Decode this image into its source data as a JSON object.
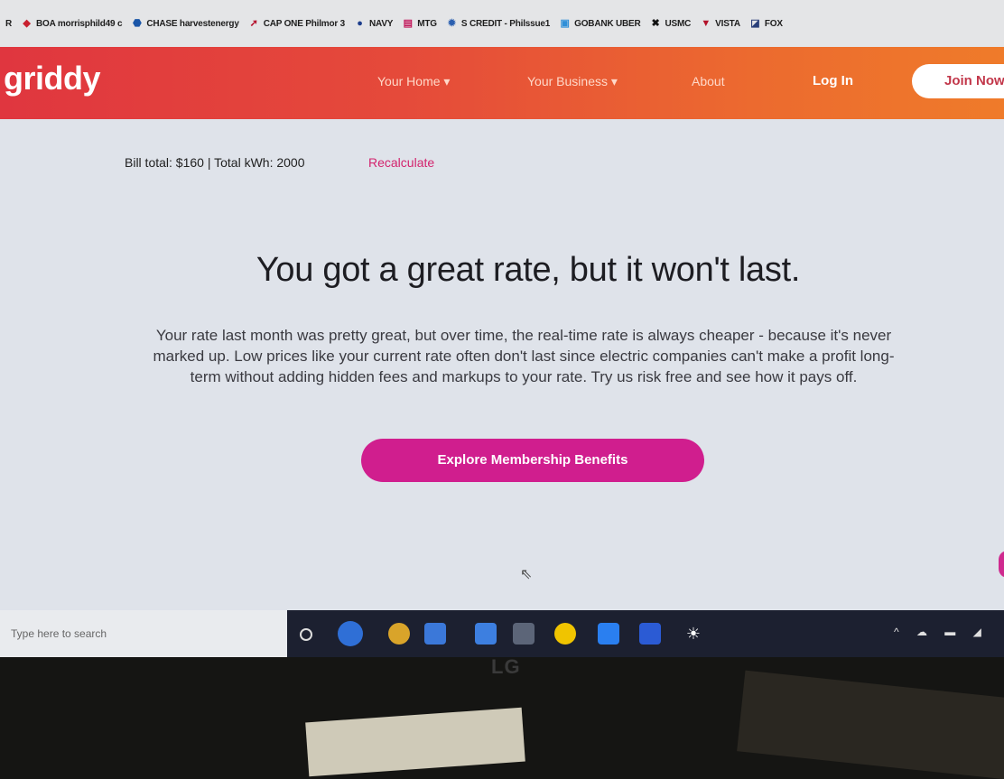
{
  "bookmarks": [
    {
      "icon": "red-chevron-icon",
      "label": "BOA morrisphild49 c"
    },
    {
      "icon": "chase-octagon-icon",
      "label": "CHASE harvestenergy"
    },
    {
      "icon": "swoosh-icon",
      "label": "CAP ONE Philmor 3"
    },
    {
      "icon": "globe-icon",
      "label": "NAVY"
    },
    {
      "icon": "bar-chart-icon",
      "label": "MTG"
    },
    {
      "icon": "gear-icon",
      "label": "S CREDIT - Philssue1"
    },
    {
      "icon": "gobank-icon",
      "label": "GOBANK UBER"
    },
    {
      "icon": "x-mark-icon",
      "label": "USMC"
    },
    {
      "icon": "triangle-icon",
      "label": "VISTA"
    },
    {
      "icon": "fox-icon",
      "label": "FOX"
    }
  ],
  "header": {
    "logo": "griddy",
    "nav": [
      "Your Home ▾",
      "Your Business ▾",
      "About"
    ],
    "login": "Log In",
    "join": "Join Now"
  },
  "bill": {
    "summary": "Bill total: $160 | Total kWh: 2000",
    "recalculate": "Recalculate"
  },
  "hero": {
    "headline": "You got a great rate, but it won't last.",
    "body": "Your rate last month was pretty great, but over time, the real-time rate is always cheaper - because it's never marked up. Low prices like your current rate often don't last since electric companies can't make a profit long-term without adding hidden fees and markups to your rate. Try us risk free and see how it pays off.",
    "cta": "Explore Membership Benefits"
  },
  "taskbar": {
    "search_placeholder": "Type here to search"
  },
  "monitor": {
    "brand": "LG"
  },
  "colors": {
    "header_start": "#e0363f",
    "header_end": "#ef7b2a",
    "cta": "#d01e8e",
    "link": "#d3246e"
  }
}
